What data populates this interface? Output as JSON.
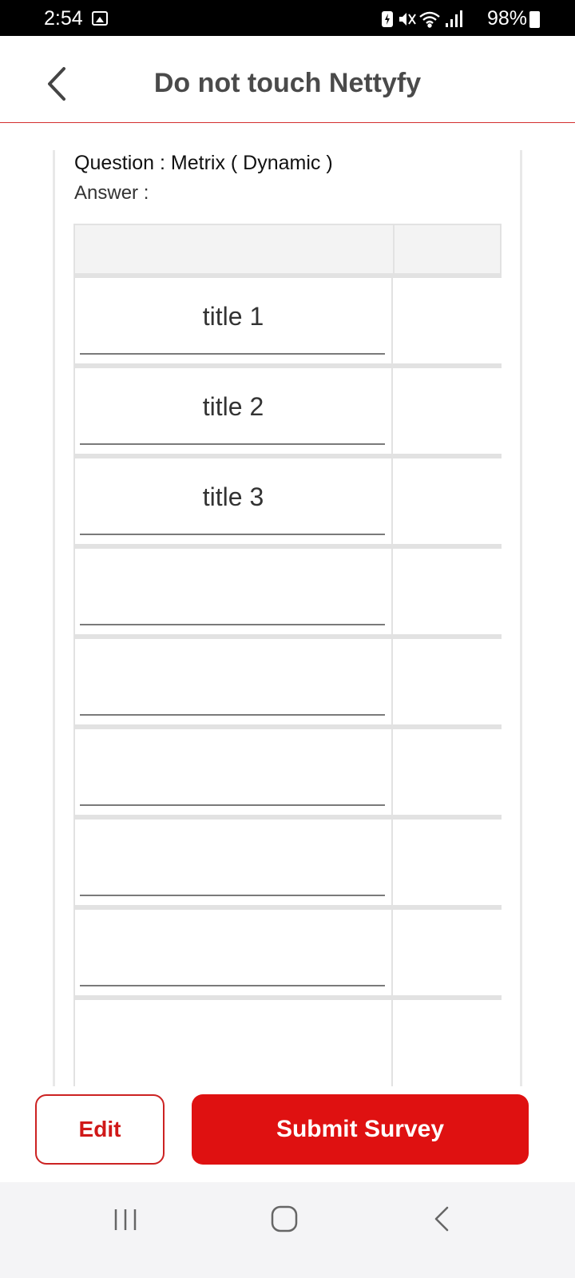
{
  "status_bar": {
    "time": "2:54",
    "battery": "98%",
    "icons": [
      "image-icon",
      "battery-saver-icon",
      "mute-icon",
      "wifi-icon",
      "signal-icon",
      "battery-icon"
    ]
  },
  "header": {
    "title": "Do not touch Nettyfy",
    "back_icon": "chevron-left-icon",
    "accent_color": "#d32f2f"
  },
  "question": {
    "label": "Question : Metrix ( Dynamic )",
    "answer_label": "Answer :"
  },
  "matrix": {
    "rows": [
      {
        "title": "title 1"
      },
      {
        "title": "title 2"
      },
      {
        "title": "title 3"
      },
      {
        "title": ""
      },
      {
        "title": ""
      },
      {
        "title": ""
      },
      {
        "title": ""
      },
      {
        "title": ""
      },
      {
        "title": ""
      }
    ]
  },
  "actions": {
    "edit_label": "Edit",
    "submit_label": "Submit Survey",
    "brand_color": "#df1111"
  },
  "nav_bar": {
    "icons": [
      "recent-apps-icon",
      "home-icon",
      "back-icon"
    ]
  }
}
